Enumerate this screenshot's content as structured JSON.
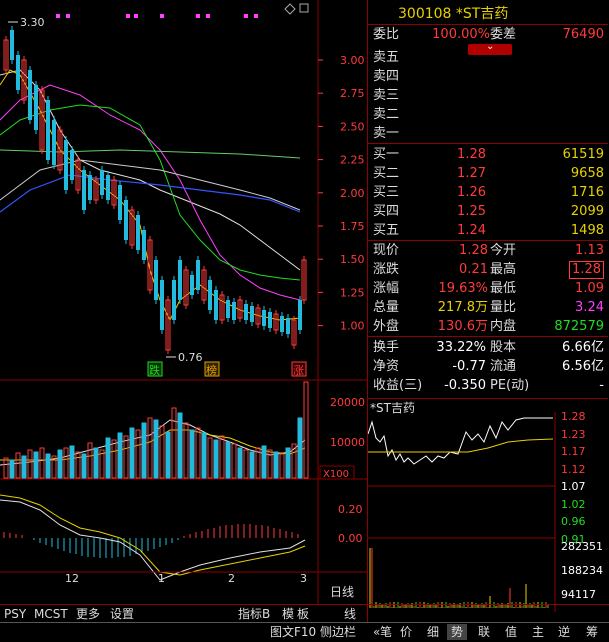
{
  "stock": {
    "code_name": "300108 *ST吉药"
  },
  "kline": {
    "price_axis": [
      "3.00",
      "2.75",
      "2.50",
      "2.25",
      "2.00",
      "1.75",
      "1.50",
      "1.25",
      "1.00"
    ],
    "high_label": "3.30",
    "low_label": "0.76",
    "marks": {
      "fall": "跌",
      "list": "榜",
      "rise": "涨"
    }
  },
  "volume": {
    "axis": [
      "20000",
      "10000"
    ],
    "unit": "X100"
  },
  "macd": {
    "axis": [
      "0.20",
      "0.00"
    ]
  },
  "time_axis": {
    "labels": [
      "12",
      "1",
      "2",
      "3"
    ],
    "period": "日线"
  },
  "quote": {
    "weibi_label": "委比",
    "weibi_value": "100.00%",
    "weicha_label": "委差",
    "weicha_value": "76490",
    "asks": [
      {
        "label": "卖五",
        "price": "",
        "vol": ""
      },
      {
        "label": "卖四",
        "price": "",
        "vol": ""
      },
      {
        "label": "卖三",
        "price": "",
        "vol": ""
      },
      {
        "label": "卖二",
        "price": "",
        "vol": ""
      },
      {
        "label": "卖一",
        "price": "",
        "vol": ""
      }
    ],
    "bids": [
      {
        "label": "买一",
        "price": "1.28",
        "vol": "61519"
      },
      {
        "label": "买二",
        "price": "1.27",
        "vol": "9658"
      },
      {
        "label": "买三",
        "price": "1.26",
        "vol": "1716"
      },
      {
        "label": "买四",
        "price": "1.25",
        "vol": "2099"
      },
      {
        "label": "买五",
        "price": "1.24",
        "vol": "1498"
      }
    ],
    "stats_left": [
      {
        "label": "现价",
        "value": "1.28"
      },
      {
        "label": "涨跌",
        "value": "0.21"
      },
      {
        "label": "涨幅",
        "value": "19.63%"
      },
      {
        "label": "总量",
        "value": "217.8万"
      },
      {
        "label": "外盘",
        "value": "130.6万"
      }
    ],
    "stats_right": [
      {
        "label": "今开",
        "value": "1.13"
      },
      {
        "label": "最高",
        "value": "1.28"
      },
      {
        "label": "最低",
        "value": "1.09"
      },
      {
        "label": "量比",
        "value": "3.24"
      },
      {
        "label": "内盘",
        "value": "872579"
      }
    ],
    "fundamentals": [
      {
        "l1": "换手",
        "v1": "33.22%",
        "l2": "股本",
        "v2": "6.66亿"
      },
      {
        "l1": "净资",
        "v1": "-0.77",
        "l2": "流通",
        "v2": "6.56亿"
      },
      {
        "l1": "收益(三)",
        "v1": "-0.350",
        "l2": "PE(动)",
        "v2": "-"
      }
    ]
  },
  "intraday": {
    "title": "*ST吉药",
    "price_axis": [
      "1.28",
      "1.23",
      "1.17",
      "1.12",
      "1.07",
      "1.02",
      "0.96",
      "0.91"
    ],
    "vol_axis": [
      "282351",
      "188234",
      "94117"
    ]
  },
  "tabs": [
    "PSY",
    "MCST",
    "更多",
    "设置",
    "指标B",
    "模",
    "板",
    "线"
  ],
  "bottom_tabs": [
    "图文F10",
    "侧边栏",
    "«",
    "笔",
    "价",
    "细",
    "势",
    "联",
    "值",
    "主",
    "逆",
    "筹"
  ],
  "colors": {
    "up": "#ff3b3b",
    "down": "#22dd22",
    "accent": "#e6d200",
    "border": "#8b0000"
  }
}
